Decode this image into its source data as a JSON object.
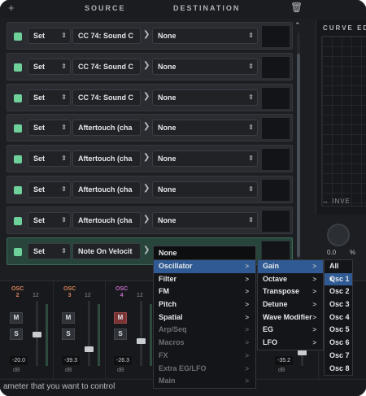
{
  "header": {
    "add_icon": "plus-icon",
    "source_label": "SOURCE",
    "destination_label": "DESTINATION",
    "delete_icon": "trash-icon"
  },
  "rows": [
    {
      "mode": "Set",
      "source": "CC 74: Sound C",
      "destination": "None",
      "active": false
    },
    {
      "mode": "Set",
      "source": "CC 74: Sound C",
      "destination": "None",
      "active": false
    },
    {
      "mode": "Set",
      "source": "CC 74: Sound C",
      "destination": "None",
      "active": false
    },
    {
      "mode": "Set",
      "source": "Aftertouch (cha",
      "destination": "None",
      "active": false
    },
    {
      "mode": "Set",
      "source": "Aftertouch (cha",
      "destination": "None",
      "active": false
    },
    {
      "mode": "Set",
      "source": "Aftertouch (cha",
      "destination": "None",
      "active": false
    },
    {
      "mode": "Set",
      "source": "Aftertouch (cha",
      "destination": "None",
      "active": false
    },
    {
      "mode": "Set",
      "source": "Note On Velocit",
      "destination": "None",
      "active": true
    }
  ],
  "curve": {
    "title": "CURVE ED",
    "invert_label": "↔ INVE",
    "knob_value": "0.0",
    "knob_unit": "%"
  },
  "menus": {
    "selected_value": "None",
    "level1": [
      {
        "label": "Oscillator",
        "enabled": true,
        "highlighted": true
      },
      {
        "label": "Filter",
        "enabled": true,
        "highlighted": false
      },
      {
        "label": "FM",
        "enabled": true,
        "highlighted": false
      },
      {
        "label": "Pitch",
        "enabled": true,
        "highlighted": false
      },
      {
        "label": "Spatial",
        "enabled": true,
        "highlighted": false
      },
      {
        "label": "Arp/Seq",
        "enabled": false,
        "highlighted": false
      },
      {
        "label": "Macros",
        "enabled": false,
        "highlighted": false
      },
      {
        "label": "FX",
        "enabled": false,
        "highlighted": false
      },
      {
        "label": "Extra EG/LFO",
        "enabled": false,
        "highlighted": false
      },
      {
        "label": "Main",
        "enabled": false,
        "highlighted": false
      }
    ],
    "level2": [
      {
        "label": "Gain",
        "highlighted": true
      },
      {
        "label": "Octave",
        "highlighted": false
      },
      {
        "label": "Transpose",
        "highlighted": false
      },
      {
        "label": "Detune",
        "highlighted": false
      },
      {
        "label": "Wave Modifier",
        "highlighted": false
      },
      {
        "label": "EG",
        "highlighted": false
      },
      {
        "label": "LFO",
        "highlighted": false
      }
    ],
    "level3": [
      {
        "label": "All",
        "highlighted": false
      },
      {
        "label": "Osc 1",
        "highlighted": true
      },
      {
        "label": "Osc 2",
        "highlighted": false
      },
      {
        "label": "Osc 3",
        "highlighted": false
      },
      {
        "label": "Osc 4",
        "highlighted": false
      },
      {
        "label": "Osc 5",
        "highlighted": false
      },
      {
        "label": "Osc 6",
        "highlighted": false
      },
      {
        "label": "Osc 7",
        "highlighted": false
      },
      {
        "label": "Osc 8",
        "highlighted": false
      }
    ],
    "submenu_arrow": ">"
  },
  "mixer": {
    "channels": [
      {
        "name": "OSC",
        "num": "2",
        "scale": "12",
        "m": "M",
        "s": "S",
        "db": "-20.0",
        "db_unit": "dB",
        "color": "#d9835a",
        "mute_on": false
      },
      {
        "name": "OSC",
        "num": "3",
        "scale": "12",
        "m": "M",
        "s": "S",
        "db": "-39.3",
        "db_unit": "dB",
        "color": "#d9835a",
        "mute_on": false
      },
      {
        "name": "OSC",
        "num": "4",
        "scale": "12",
        "m": "M",
        "s": "S",
        "db": "-26.3",
        "db_unit": "dB",
        "color": "#c46ac7",
        "mute_on": true
      }
    ],
    "right_db": "-35.2",
    "right_db_unit": "dB"
  },
  "status": {
    "text": "ameter that you want to control"
  },
  "colors": {
    "accent_green": "#6ed19a",
    "active_row": "#28453b",
    "menu_highlight": "#2f5a93"
  }
}
